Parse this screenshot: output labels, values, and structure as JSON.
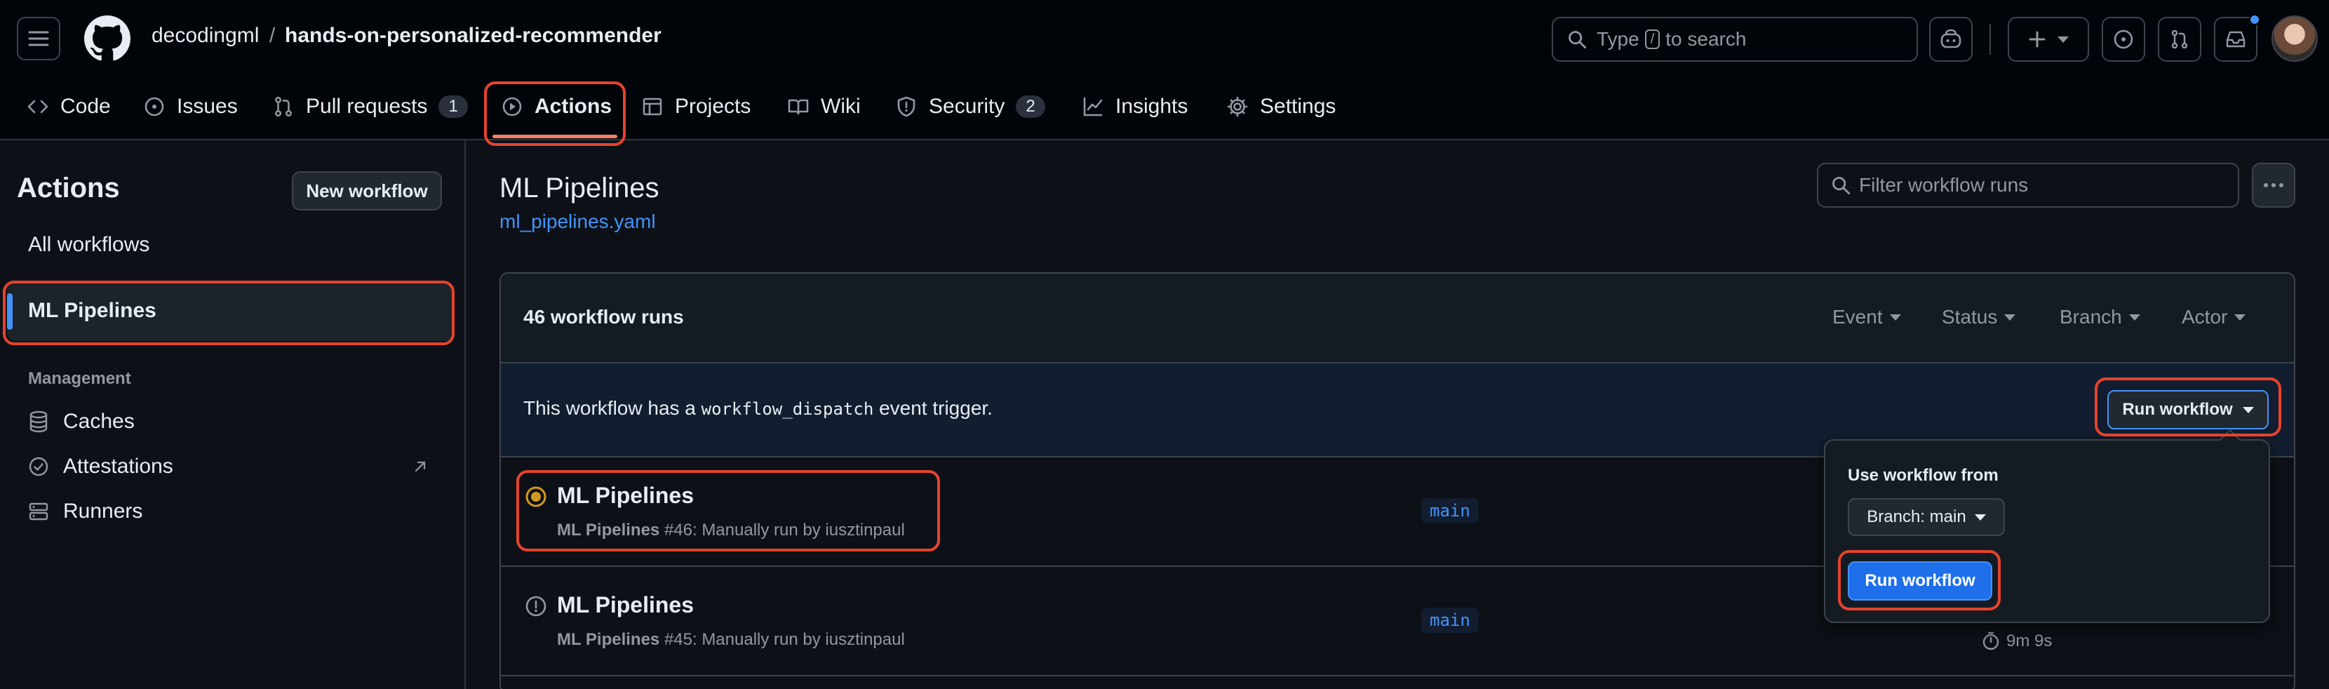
{
  "colors": {
    "accent": "#4493f8",
    "annotation": "#e5432d",
    "in_progress": "#d29922",
    "tab_underline": "#f78166"
  },
  "header": {
    "owner": "decodingml",
    "separator": "/",
    "repo": "hands-on-personalized-recommender",
    "search_prefix": "Type",
    "search_key": "/",
    "search_suffix": "to search",
    "icons": [
      "menu-icon",
      "github-logo-icon",
      "search-icon",
      "copilot-icon",
      "plus-icon",
      "issue-icon",
      "pull-request-icon",
      "inbox-icon"
    ]
  },
  "tabs": [
    {
      "label": "Code",
      "icon": "code-icon"
    },
    {
      "label": "Issues",
      "icon": "issue-icon"
    },
    {
      "label": "Pull requests",
      "icon": "pull-request-icon",
      "count": "1"
    },
    {
      "label": "Actions",
      "icon": "play-icon",
      "active": true
    },
    {
      "label": "Projects",
      "icon": "table-icon"
    },
    {
      "label": "Wiki",
      "icon": "book-icon"
    },
    {
      "label": "Security",
      "icon": "shield-icon",
      "count": "2"
    },
    {
      "label": "Insights",
      "icon": "graph-icon"
    },
    {
      "label": "Settings",
      "icon": "gear-icon"
    }
  ],
  "sidebar": {
    "title": "Actions",
    "new_workflow": "New workflow",
    "all_workflows": "All workflows",
    "selected_workflow": "ML Pipelines",
    "management_heading": "Management",
    "management_items": [
      {
        "label": "Caches",
        "icon": "database-icon"
      },
      {
        "label": "Attestations",
        "icon": "verified-icon"
      },
      {
        "label": "Runners",
        "icon": "server-icon"
      }
    ]
  },
  "main": {
    "title": "ML Pipelines",
    "file": "ml_pipelines.yaml",
    "filter_placeholder": "Filter workflow runs",
    "runs_count": "46 workflow runs",
    "filters": [
      "Event",
      "Status",
      "Branch",
      "Actor"
    ],
    "dispatch_prefix": "This workflow has a",
    "dispatch_code": "workflow_dispatch",
    "dispatch_suffix": "event trigger.",
    "run_workflow_label": "Run workflow",
    "runs": [
      {
        "title": "ML Pipelines",
        "workflow": "ML Pipelines",
        "detail": "#46: Manually run by iusztinpaul",
        "branch": "main",
        "status": "in-progress"
      },
      {
        "title": "ML Pipelines",
        "workflow": "ML Pipelines",
        "detail": "#45: Manually run by iusztinpaul",
        "branch": "main",
        "status": "failed",
        "duration": "9m 9s"
      }
    ]
  },
  "popover": {
    "label": "Use workflow from",
    "branch_button": "Branch: main",
    "run_button": "Run workflow"
  }
}
